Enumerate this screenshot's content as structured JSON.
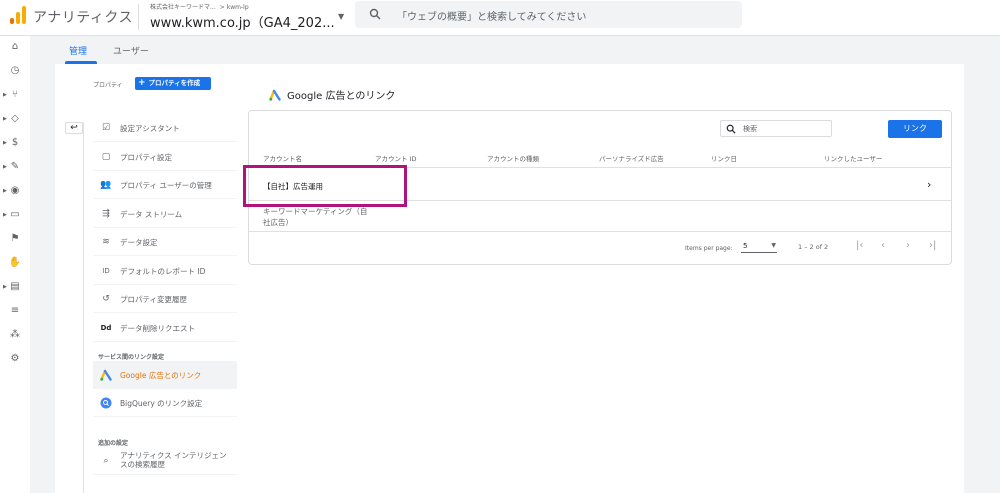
{
  "header": {
    "app_title": "アナリティクス",
    "account_name": "株式会社キーワードマ...",
    "breadcrumb_sep": ">",
    "account_sub": "kwm-lp",
    "property_name": "www.kwm.co.jp（GA4_202...",
    "search_placeholder": "「ウェブの概要」と検索してみてください"
  },
  "tabs": [
    {
      "label": "管理"
    },
    {
      "label": "ユーザー"
    }
  ],
  "property_panel": {
    "label": "プロパティ",
    "create_button": "プロパティを作成",
    "items": [
      {
        "label": "設定アシスタント",
        "icon": "checkbox-icon"
      },
      {
        "label": "プロパティ設定",
        "icon": "window-icon"
      },
      {
        "label": "プロパティ ユーザーの管理",
        "icon": "people-icon"
      },
      {
        "label": "データ ストリーム",
        "icon": "streams-icon"
      },
      {
        "label": "データ設定",
        "icon": "database-icon"
      },
      {
        "label": "デフォルトのレポート ID",
        "icon": "report-id-icon",
        "icon_text": "ID"
      },
      {
        "label": "プロパティ変更履歴",
        "icon": "history-icon"
      },
      {
        "label": "データ削除リクエスト",
        "icon": "delete-data-icon",
        "icon_text": "Dd"
      }
    ],
    "section_links": "サービス間のリンク設定",
    "link_items": [
      {
        "label": "Google 広告とのリンク",
        "icon": "google-ads-icon"
      },
      {
        "label": "BigQuery のリンク設定",
        "icon": "bigquery-icon"
      }
    ],
    "section_extra": "追加の設定",
    "extra_items": [
      {
        "label": "アナリティクス インテリジェンスの検索履歴",
        "icon": "intelligence-icon"
      }
    ]
  },
  "content": {
    "title": "Google 広告とのリンク",
    "search_placeholder": "検索",
    "link_button": "リンク",
    "columns": [
      "アカウント名",
      "アカウント ID",
      "アカウントの種類",
      "パーソナライズド広告",
      "リンク日",
      "リンクしたユーザー"
    ],
    "rows": [
      {
        "account_name": "【自社】広告運用"
      },
      {
        "account_name": "キーワードマーケティング（自社広告）"
      }
    ],
    "items_per_page_label": "Items per page:",
    "items_per_page_value": "5",
    "range": "1 – 2 of 2"
  },
  "colors": {
    "accent": "#1a73e8",
    "active_nav": "#e8710a",
    "highlight": "#b0127f",
    "logo": "#f9ab00"
  }
}
